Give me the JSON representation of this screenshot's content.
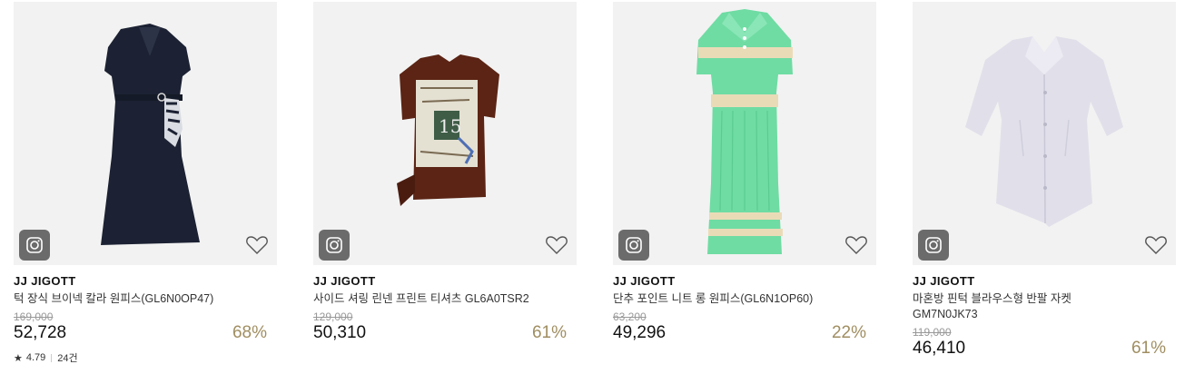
{
  "products": [
    {
      "brand": "JJ JIGOTT",
      "name": "턱 장식 브이넥 칼라 원피스(GL6N0OP47)",
      "original_price": "169,000",
      "price": "52,728",
      "discount": "68%",
      "rating": "4.79",
      "review_count": "24건",
      "image_icon": "navy-belted-dress-image"
    },
    {
      "brand": "JJ JIGOTT",
      "name": "사이드 셔링 린넨 프린트 티셔츠 GL6A0TSR2",
      "original_price": "129,000",
      "price": "50,310",
      "discount": "61%",
      "image_icon": "brown-print-tshirt-image"
    },
    {
      "brand": "JJ JIGOTT",
      "name": "단추 포인트 니트 롱 원피스(GL6N1OP60)",
      "original_price": "63,200",
      "price": "49,296",
      "discount": "22%",
      "image_icon": "mint-knit-dress-image"
    },
    {
      "brand": "JJ JIGOTT",
      "name": "마혼방 핀턱 블라우스형 반팔 자켓 GM7N0JK73",
      "original_price": "119,000",
      "price": "46,410",
      "discount": "61%",
      "image_icon": "lavender-blouse-jacket-image"
    }
  ],
  "colors": {
    "discount": "#a08e61",
    "badge": "#6b6b6b",
    "thumb_bg": "#f2f2f2"
  }
}
